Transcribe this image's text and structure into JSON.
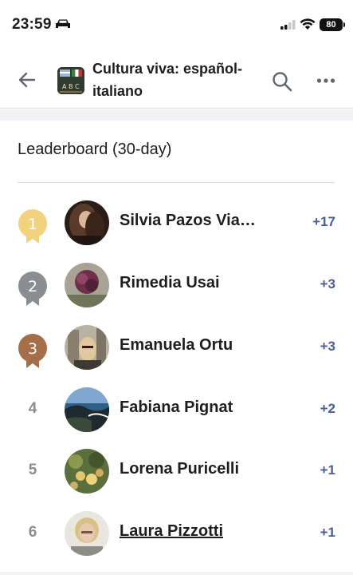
{
  "status_bar": {
    "time": "23:59",
    "battery": "80"
  },
  "header": {
    "title": "Cultura viva: español-italiano"
  },
  "leaderboard": {
    "title": "Leaderboard (30-day)",
    "entries": [
      {
        "rank": "1",
        "name": "Silvia Pazos Via…",
        "points": "+17",
        "medal": "gold"
      },
      {
        "rank": "2",
        "name": "Rimedia Usai",
        "points": "+3",
        "medal": "silver"
      },
      {
        "rank": "3",
        "name": "Emanuela Ortu",
        "points": "+3",
        "medal": "bronze"
      },
      {
        "rank": "4",
        "name": "Fabiana Pignat",
        "points": "+2",
        "medal": "none"
      },
      {
        "rank": "5",
        "name": "Lorena Puricelli",
        "points": "+1",
        "medal": "none"
      },
      {
        "rank": "6",
        "name": "Laura Pizzotti",
        "points": "+1",
        "medal": "none"
      }
    ]
  },
  "colors": {
    "gold": "#f2d27c",
    "silver": "#8a8d91",
    "bronze": "#a36e48",
    "points": "#4a5e9c"
  }
}
